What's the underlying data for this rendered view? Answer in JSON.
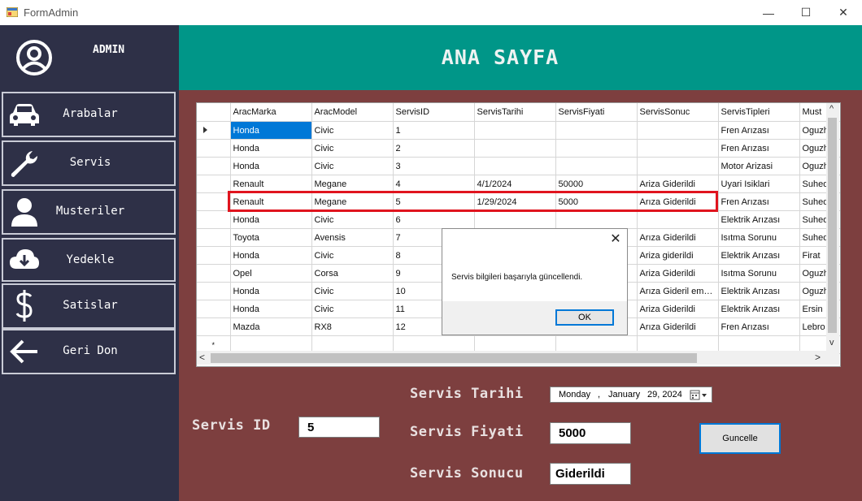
{
  "window": {
    "title": "FormAdmin",
    "minimize_glyph": "—",
    "maximize_glyph": "☐",
    "close_glyph": "✕"
  },
  "sidebar": {
    "user_label": "ADMIN",
    "user_icon": "user-circle-icon",
    "items": [
      {
        "label": "Arabalar",
        "icon": "car-icon"
      },
      {
        "label": "Servis",
        "icon": "wrench-icon"
      },
      {
        "label": "Musteriler",
        "icon": "user-icon"
      },
      {
        "label": "Yedekle",
        "icon": "cloud-download-icon"
      },
      {
        "label": "Satislar",
        "icon": "dollar-icon"
      },
      {
        "label": "Geri Don",
        "icon": "arrow-left-icon"
      }
    ]
  },
  "header": {
    "title": "ANA SAYFA"
  },
  "grid": {
    "columns": [
      "AracMarka",
      "AracModel",
      "ServisID",
      "ServisTarihi",
      "ServisFiyati",
      "ServisSonuc",
      "ServisTipleri",
      "Must"
    ],
    "rows": [
      [
        "Honda",
        "Civic",
        "1",
        "",
        "",
        "",
        "Fren Arızası",
        "Oguzh"
      ],
      [
        "Honda",
        "Civic",
        "2",
        "",
        "",
        "",
        "Fren Arızası",
        "Oguzh"
      ],
      [
        "Honda",
        "Civic",
        "3",
        "",
        "",
        "",
        "Motor Arizasi",
        "Oguzh"
      ],
      [
        "Renault",
        "Megane",
        "4",
        "4/1/2024",
        "50000",
        "Ariza Giderildi",
        "Uyari Isiklari",
        "Suhed"
      ],
      [
        "Renault",
        "Megane",
        "5",
        "1/29/2024",
        "5000",
        " Arıza Giderildi",
        "Fren Arızası",
        "Suhed"
      ],
      [
        "Honda",
        "Civic",
        "6",
        "",
        "",
        "",
        "Elektrik Arızası",
        "Suhed"
      ],
      [
        "Toyota",
        "Avensis",
        "7",
        "",
        "",
        " Arıza Giderildi",
        "Isıtma Sorunu",
        "Suhed"
      ],
      [
        "Honda",
        "Civic",
        "8",
        "",
        "",
        "Ariza giderildi",
        "Elektrik Arızası",
        "Firat"
      ],
      [
        "Opel",
        "Corsa",
        "9",
        "",
        "",
        "Ariza Giderildi",
        "Isıtma Sorunu",
        "Oguzh"
      ],
      [
        "Honda",
        "Civic",
        "10",
        "",
        "",
        " Arıza Gideril eme...",
        "Elektrik Arızası",
        "Oguzh"
      ],
      [
        "Honda",
        "Civic",
        "11",
        "",
        "",
        "Ariza Giderildi",
        "Elektrik Arızası",
        "Ersin"
      ],
      [
        "Mazda",
        "RX8",
        "12",
        "",
        "",
        " Arıza Giderildi",
        "Fren Arızası",
        "Lebro"
      ]
    ],
    "new_row_marker": "*",
    "scroll_left": "<",
    "scroll_right": ">",
    "scroll_up": "^",
    "scroll_down": "v"
  },
  "dialog": {
    "message": "Servis bilgileri başarıyla güncellendi.",
    "ok_label": "OK",
    "close_glyph": "✕"
  },
  "form": {
    "servis_id_label": "Servis ID",
    "servis_id_value": "5",
    "servis_tarihi_label": "Servis Tarihi",
    "servis_tarihi_day": "Monday",
    "servis_tarihi_sep": ",",
    "servis_tarihi_month": "January",
    "servis_tarihi_date": "29, 2024",
    "servis_fiyati_label": "Servis Fiyati",
    "servis_fiyati_value": "5000",
    "servis_sonucu_label": "Servis Sonucu",
    "servis_sonucu_value": "Giderildi",
    "update_button": "Guncelle"
  },
  "colors": {
    "sidebar": "#2e3047",
    "header": "#009688",
    "main": "#7d3f3f",
    "highlight": "#e0141e",
    "selection": "#0078d7"
  }
}
